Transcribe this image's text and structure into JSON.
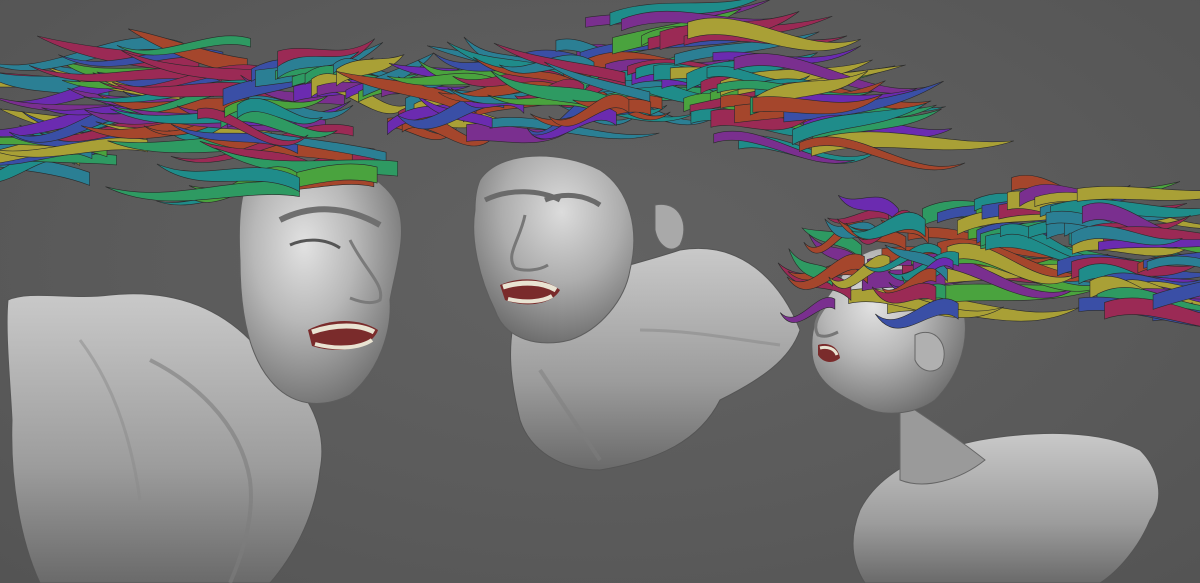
{
  "scene": {
    "background": "#5b5b5b",
    "skin_color": "#b9b9b9",
    "skin_shadow": "#7f7f7f",
    "skin_highlight": "#e6e6e6",
    "mouth_color": "#7a2b2b",
    "teeth_color": "#e9e3d2",
    "hair_palette": [
      "#7a2f8f",
      "#2b7f94",
      "#2e9a62",
      "#9b2a55",
      "#3a4fa6",
      "#a9a036",
      "#4aa33e",
      "#a5462c",
      "#6b2bb0",
      "#1f8c8a"
    ],
    "views": [
      {
        "name": "three-quarter-right"
      },
      {
        "name": "front-three-quarter-left"
      },
      {
        "name": "profile-left"
      }
    ]
  }
}
